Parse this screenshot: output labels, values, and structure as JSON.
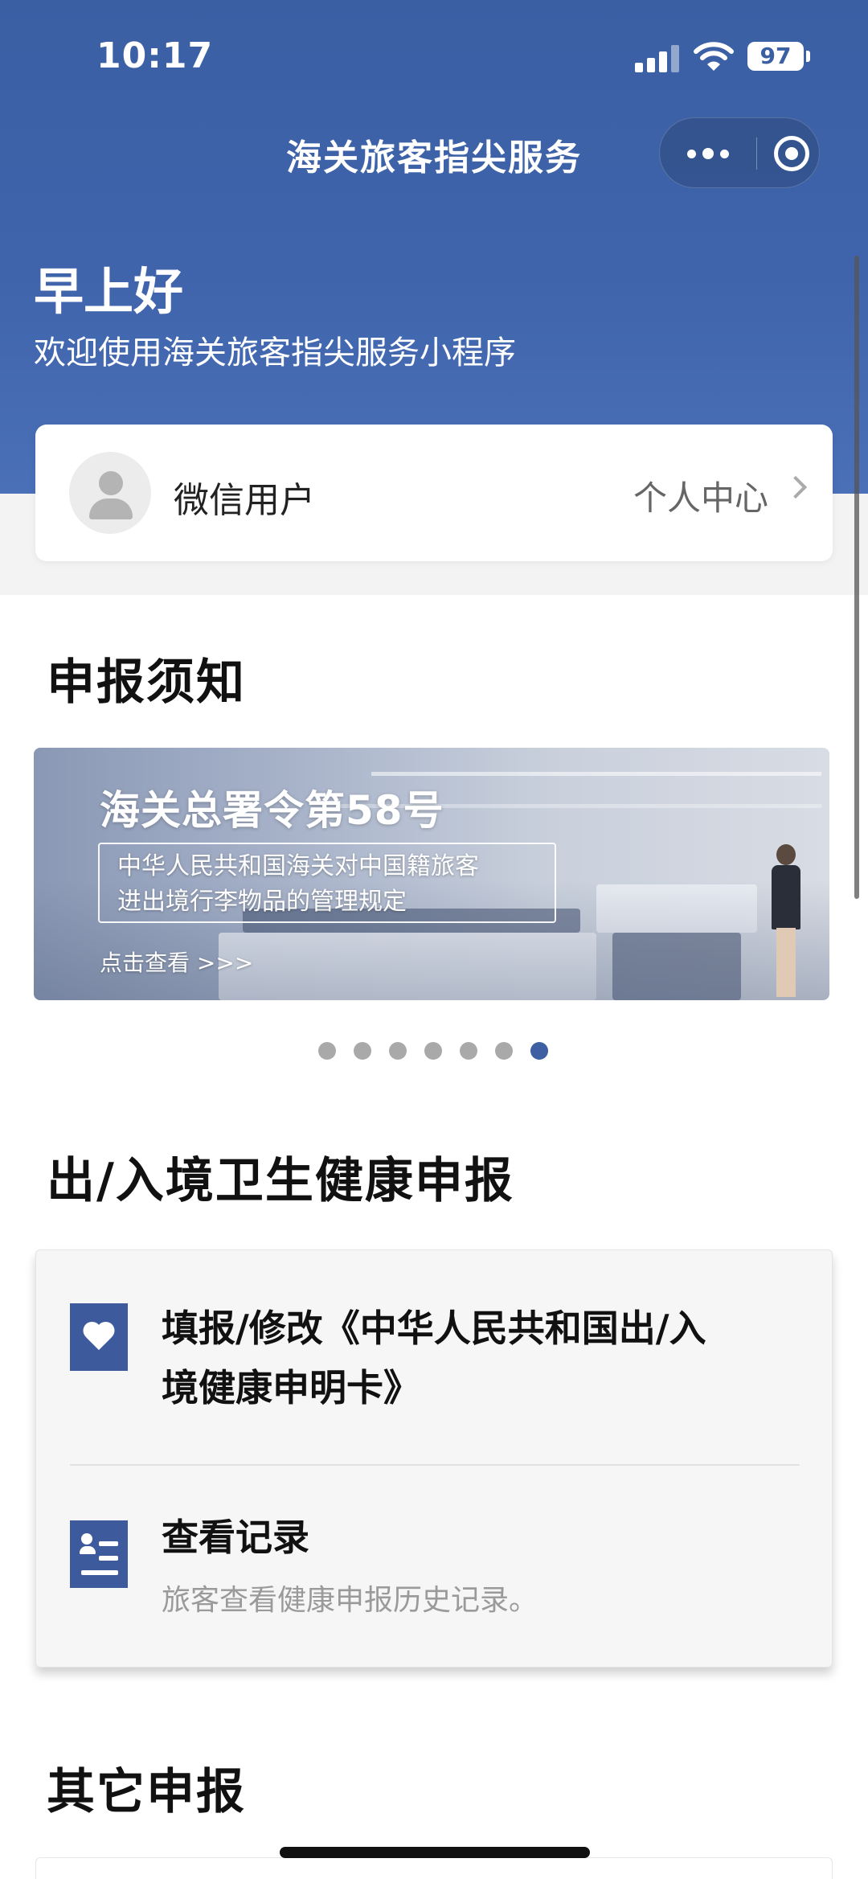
{
  "status_bar": {
    "time": "10:17",
    "battery": "97"
  },
  "nav": {
    "title": "海关旅客指尖服务",
    "more_icon": "more-dots-icon",
    "close_icon": "target-close-icon"
  },
  "header": {
    "greeting": "早上好",
    "welcome": "欢迎使用海关旅客指尖服务小程序"
  },
  "user": {
    "name": "微信用户",
    "personal_center": "个人中心"
  },
  "notice": {
    "title": "申报须知",
    "banner": {
      "title": "海关总署令第58号",
      "line1": "中华人民共和国海关对中国籍旅客",
      "line2": "进出境行李物品的管理规定",
      "link": "点击查看 >>>"
    },
    "carousel": {
      "count": 7,
      "active_index": 6
    }
  },
  "health": {
    "title": "出/入境卫生健康申报",
    "items": [
      {
        "label_line1": "填报/修改《中华人民共和国出/入",
        "label_line2": "境健康申明卡》",
        "icon": "heart-icon"
      },
      {
        "label": "查看记录",
        "description": "旅客查看健康申报历史记录。",
        "icon": "record-list-icon"
      }
    ]
  },
  "other": {
    "title": "其它申报"
  },
  "colors": {
    "brand_blue": "#3f5fa3",
    "icon_blue": "#3d5a9c"
  }
}
